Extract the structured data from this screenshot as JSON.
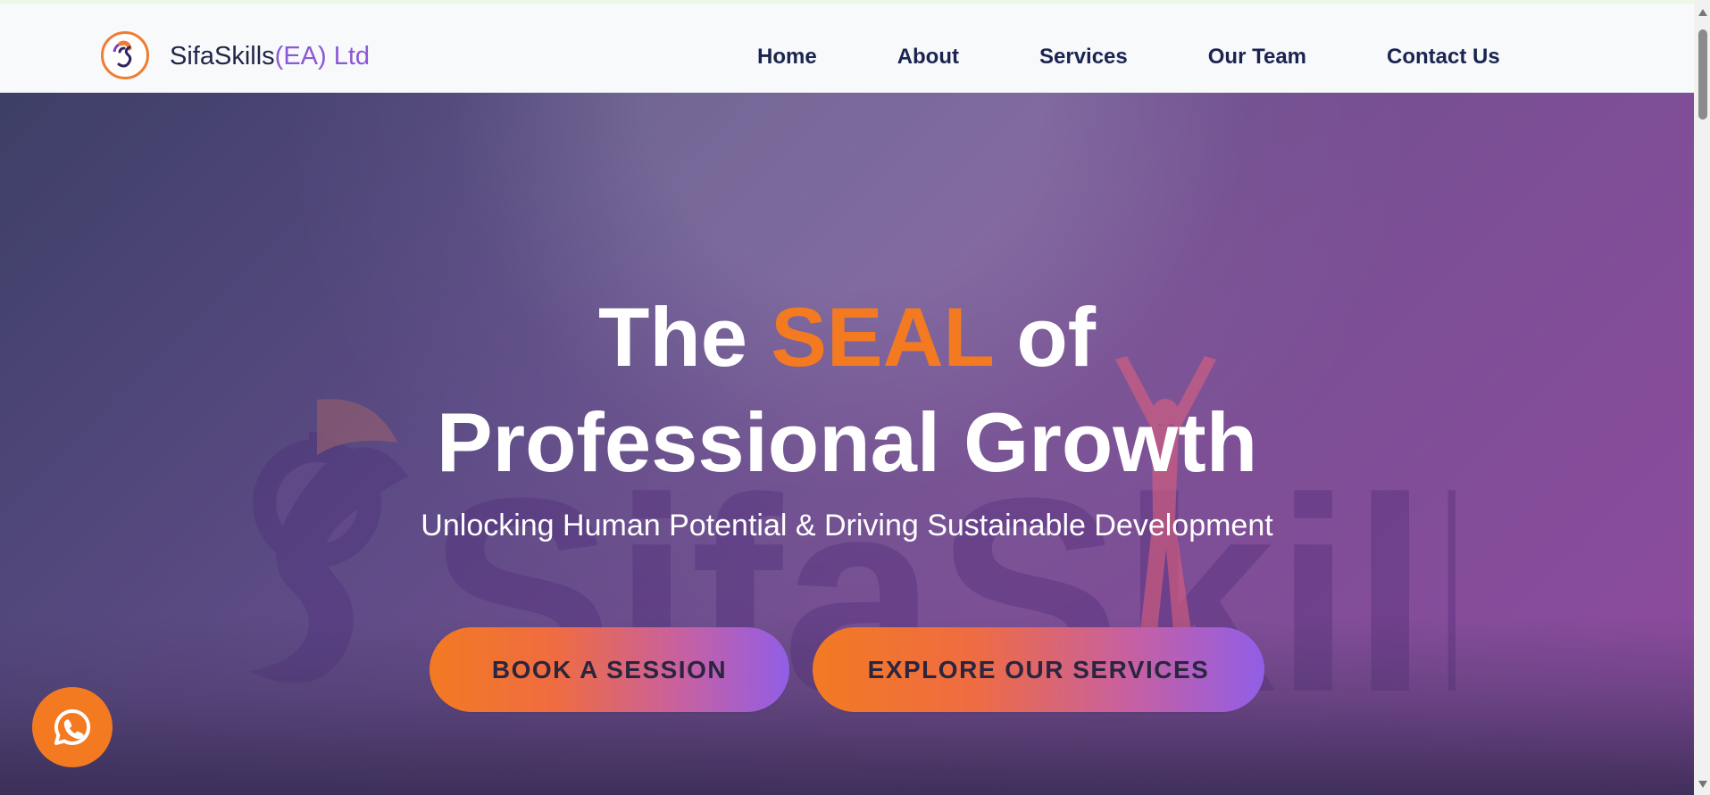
{
  "header": {
    "brand_main": "SifaSkills",
    "brand_sub": "(EA) Ltd",
    "nav": [
      "Home",
      "About",
      "Services",
      "Our Team",
      "Contact Us"
    ]
  },
  "hero": {
    "headline_part1": "The",
    "headline_accent": "SEAL",
    "headline_part2": "of",
    "headline_line2": "Professional Growth",
    "subheadline": "Unlocking Human Potential & Driving Sustainable Development",
    "watermark_text": "SifaSkills"
  },
  "buttons": {
    "book": "BOOK A SESSION",
    "explore": "EXPLORE OUR SERVICES"
  },
  "icons": {
    "logo": "sifaskills-logo-icon",
    "whatsapp": "whatsapp-icon",
    "scroll_up": "scroll-up-arrow-icon",
    "scroll_down": "scroll-down-arrow-icon"
  },
  "colors": {
    "accent": "#f47a22",
    "brand_purple": "#8b58d8",
    "nav_text": "#1b2450",
    "hero_start": "#3d3f67",
    "hero_end": "#8f4aa0"
  }
}
